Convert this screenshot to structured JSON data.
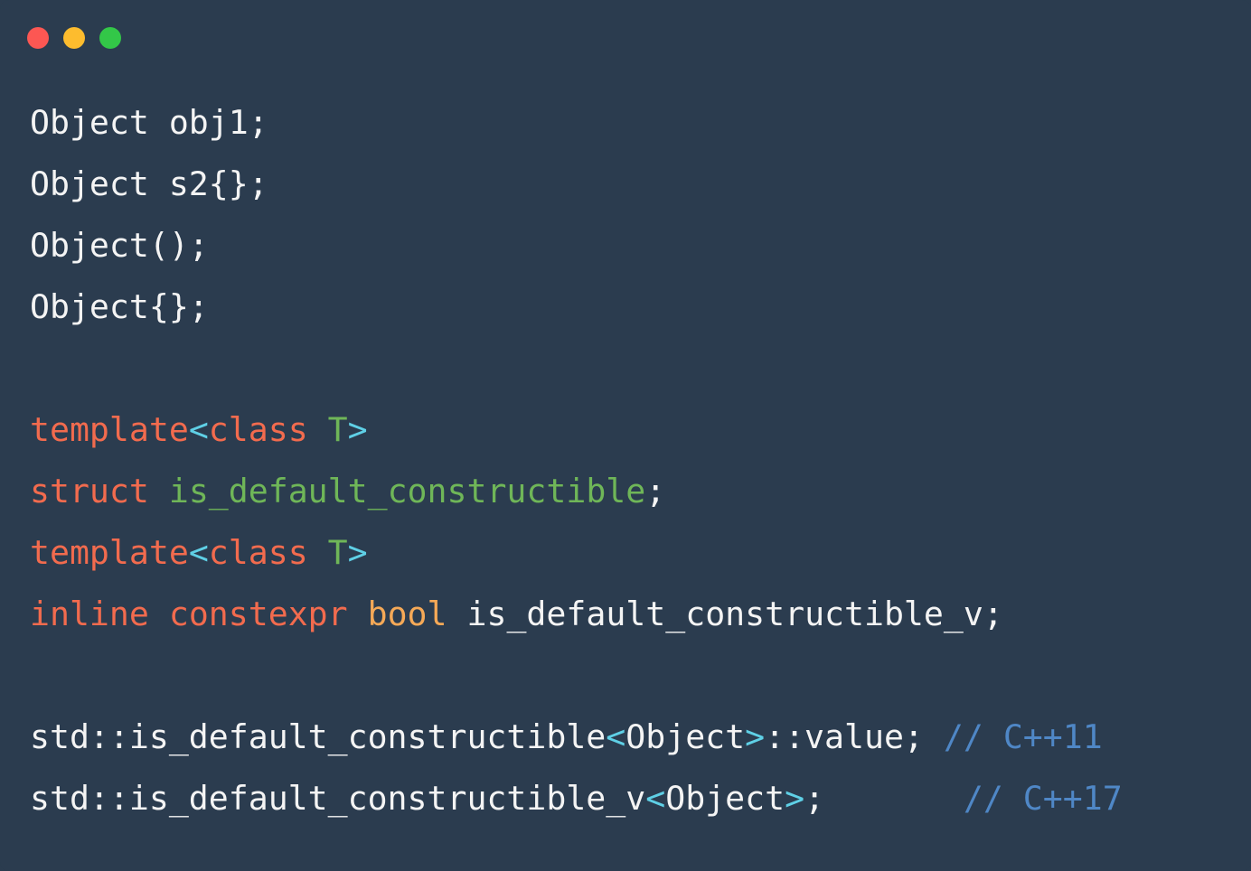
{
  "window_controls": {
    "close": {
      "color": "#fc5753"
    },
    "minimize": {
      "color": "#fdbc2e"
    },
    "maximize": {
      "color": "#33c748"
    }
  },
  "colors": {
    "background": "#2b3c4f",
    "plain": "#f4f4f4",
    "keyword": "#f26b4e",
    "type": "#f5a957",
    "identifier": "#6fb658",
    "punct": "#5fd0e6",
    "comment": "#4f87c6"
  },
  "code_lines": [
    [
      {
        "text": "Object obj1;",
        "kind": "plain"
      }
    ],
    [
      {
        "text": "Object s2{};",
        "kind": "plain"
      }
    ],
    [
      {
        "text": "Object();",
        "kind": "plain"
      }
    ],
    [
      {
        "text": "Object{};",
        "kind": "plain"
      }
    ],
    [],
    [
      {
        "text": "template",
        "kind": "keyword"
      },
      {
        "text": "<",
        "kind": "punct"
      },
      {
        "text": "class",
        "kind": "keyword"
      },
      {
        "text": " ",
        "kind": "plain"
      },
      {
        "text": "T",
        "kind": "identifier"
      },
      {
        "text": ">",
        "kind": "punct"
      }
    ],
    [
      {
        "text": "struct",
        "kind": "keyword"
      },
      {
        "text": " ",
        "kind": "plain"
      },
      {
        "text": "is_default_constructible",
        "kind": "identifier"
      },
      {
        "text": ";",
        "kind": "plain"
      }
    ],
    [
      {
        "text": "template",
        "kind": "keyword"
      },
      {
        "text": "<",
        "kind": "punct"
      },
      {
        "text": "class",
        "kind": "keyword"
      },
      {
        "text": " ",
        "kind": "plain"
      },
      {
        "text": "T",
        "kind": "identifier"
      },
      {
        "text": ">",
        "kind": "punct"
      }
    ],
    [
      {
        "text": "inline",
        "kind": "keyword"
      },
      {
        "text": " ",
        "kind": "plain"
      },
      {
        "text": "constexpr",
        "kind": "keyword"
      },
      {
        "text": " ",
        "kind": "plain"
      },
      {
        "text": "bool",
        "kind": "type"
      },
      {
        "text": " is_default_constructible_v;",
        "kind": "plain"
      }
    ],
    [],
    [
      {
        "text": "std::is_default_constructible",
        "kind": "plain"
      },
      {
        "text": "<",
        "kind": "punct"
      },
      {
        "text": "Object",
        "kind": "plain"
      },
      {
        "text": ">",
        "kind": "punct"
      },
      {
        "text": "::value; ",
        "kind": "plain"
      },
      {
        "text": "// C++11",
        "kind": "comment"
      }
    ],
    [
      {
        "text": "std::is_default_constructible_v",
        "kind": "plain"
      },
      {
        "text": "<",
        "kind": "punct"
      },
      {
        "text": "Object",
        "kind": "plain"
      },
      {
        "text": ">",
        "kind": "punct"
      },
      {
        "text": ";       ",
        "kind": "plain"
      },
      {
        "text": "// C++17",
        "kind": "comment"
      }
    ]
  ]
}
